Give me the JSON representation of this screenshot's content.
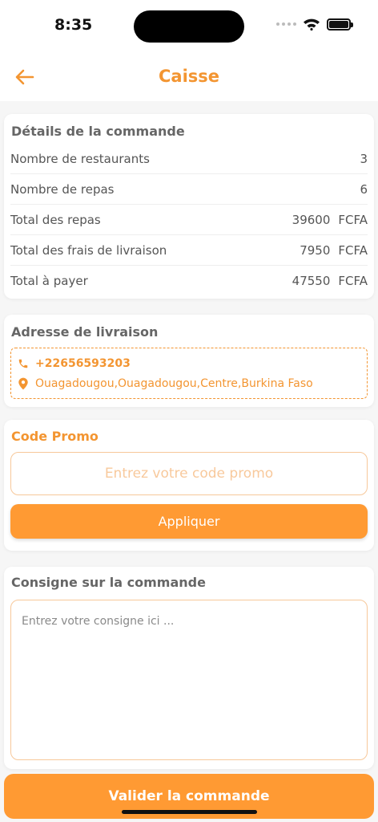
{
  "status": {
    "time": "8:35"
  },
  "header": {
    "title": "Caisse"
  },
  "details": {
    "title": "Détails de la commande",
    "rows": [
      {
        "label": "Nombre de restaurants",
        "value": "3",
        "unit": ""
      },
      {
        "label": "Nombre de repas",
        "value": "6",
        "unit": ""
      },
      {
        "label": "Total des repas",
        "value": "39600",
        "unit": "FCFA"
      },
      {
        "label": "Total des frais de livraison",
        "value": "7950",
        "unit": "FCFA"
      },
      {
        "label": "Total à payer",
        "value": "47550",
        "unit": "FCFA"
      }
    ]
  },
  "address": {
    "title": "Adresse de livraison",
    "phone": "+22656593203",
    "location": "Ouagadougou,Ouagadougou,Centre,Burkina Faso"
  },
  "promo": {
    "title": "Code Promo",
    "placeholder": "Entrez votre code promo",
    "apply_label": "Appliquer"
  },
  "consigne": {
    "title": "Consigne sur la commande",
    "placeholder": "Entrez votre consigne ici ..."
  },
  "footer": {
    "validate_label": "Valider la commande"
  },
  "colors": {
    "accent": "#ff9a33",
    "accent_light": "#f7c89a"
  }
}
